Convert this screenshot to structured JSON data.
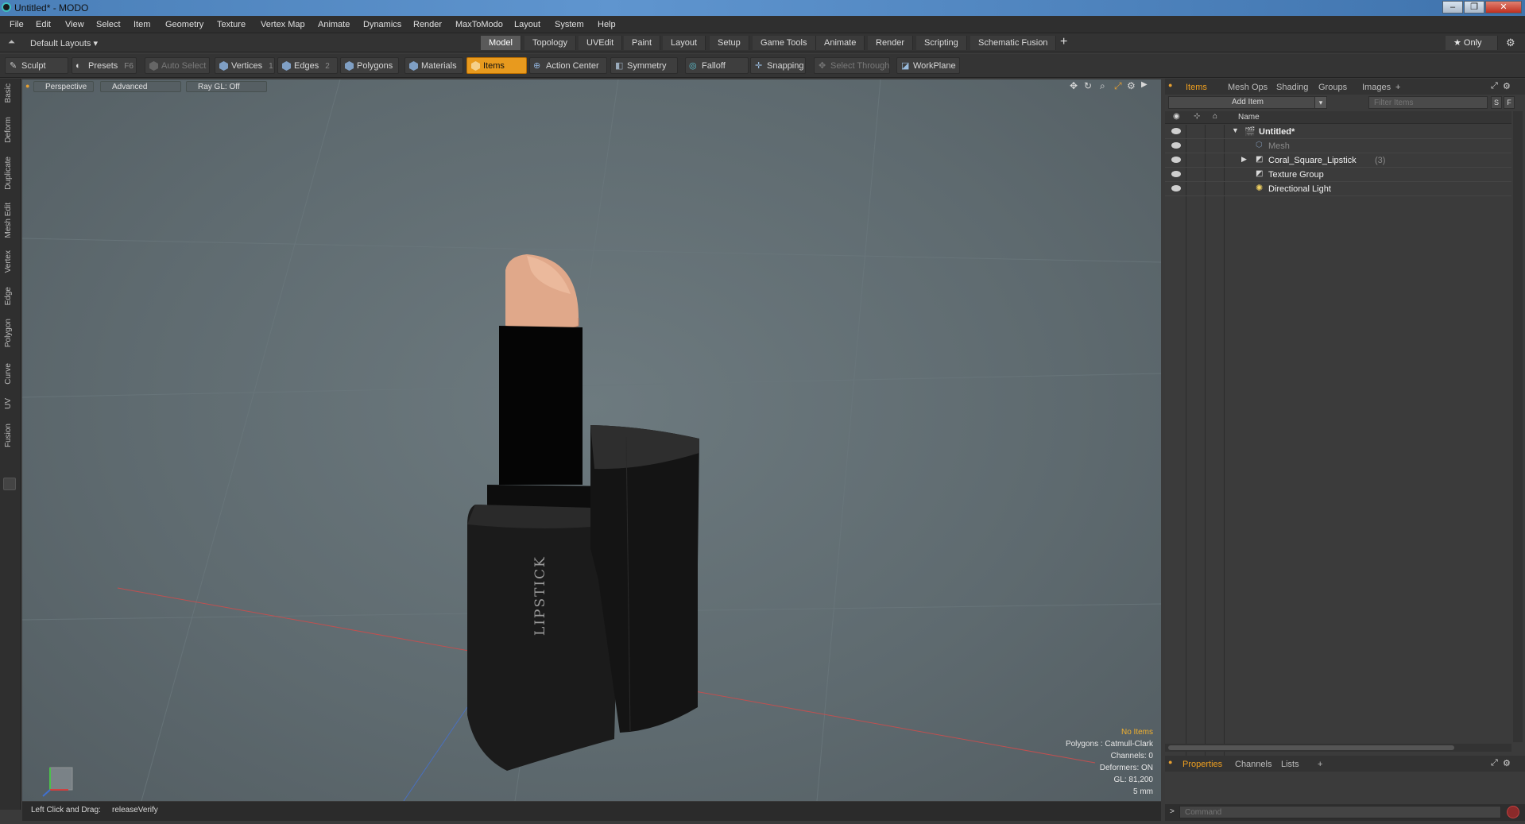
{
  "window": {
    "title": "Untitled* - MODO",
    "min": "–",
    "max": "❐",
    "close": "✕"
  },
  "menu": [
    "File",
    "Edit",
    "View",
    "Select",
    "Item",
    "Geometry",
    "Texture",
    "Vertex Map",
    "Animate",
    "Dynamics",
    "Render",
    "MaxToModo",
    "Layout",
    "System",
    "Help"
  ],
  "layouts": {
    "dropdown": "Default Layouts ▾",
    "tabs": [
      "Model",
      "Topology",
      "UVEdit",
      "Paint",
      "Layout",
      "Setup",
      "Game Tools",
      "Animate",
      "Render",
      "Scripting",
      "Schematic Fusion"
    ],
    "add": "+",
    "only": "★  Only",
    "settings": "⚙"
  },
  "toolbar": {
    "sculpt": "Sculpt",
    "presets": "Presets",
    "presets_key": "F6",
    "auto_select": "Auto Select",
    "vertices": "Vertices",
    "vertices_key": "1",
    "edges": "Edges",
    "edges_key": "2",
    "polygons": "Polygons",
    "materials": "Materials",
    "items": "Items",
    "action_center": "Action Center",
    "symmetry": "Symmetry",
    "falloff": "Falloff",
    "snapping": "Snapping",
    "select_through": "Select Through",
    "workplane": "WorkPlane"
  },
  "left_tabs": [
    "Basic",
    "Deform",
    "Duplicate",
    "Mesh Edit",
    "Vertex",
    "Edge",
    "Polygon",
    "Curve",
    "UV",
    "Fusion"
  ],
  "viewport": {
    "perspective": "Perspective",
    "advanced": "Advanced",
    "raygl": "Ray GL: Off",
    "model_label": "LIPSTICK",
    "stats": {
      "no_items": "No Items",
      "polygons": "Polygons : Catmull-Clark",
      "channels": "Channels: 0",
      "deformers": "Deformers: ON",
      "gl": "GL: 81,200",
      "scale": "5 mm"
    }
  },
  "status": {
    "hint": "Left Click and Drag:",
    "action": "releaseVerify"
  },
  "items_panel": {
    "tabs": [
      "Items",
      "Mesh Ops",
      "Shading",
      "Groups",
      "Images",
      "+"
    ],
    "add_item": "Add Item",
    "filter_placeholder": "Filter Items",
    "s_btn": "S",
    "f_btn": "F",
    "column_name": "Name",
    "tree": [
      {
        "label": "Untitled*",
        "extra": ""
      },
      {
        "label": "Mesh",
        "extra": ""
      },
      {
        "label": "Coral_Square_Lipstick",
        "extra": "(3)"
      },
      {
        "label": "Texture Group",
        "extra": ""
      },
      {
        "label": "Directional Light",
        "extra": ""
      }
    ]
  },
  "props_panel": {
    "tabs": [
      "Properties",
      "Channels",
      "Lists",
      "+"
    ]
  },
  "command": {
    "placeholder": "Command"
  },
  "colors": {
    "accent": "#e89a1e",
    "viewport_bg": "#5e6a6f",
    "lipstick": "#e0a88a"
  }
}
